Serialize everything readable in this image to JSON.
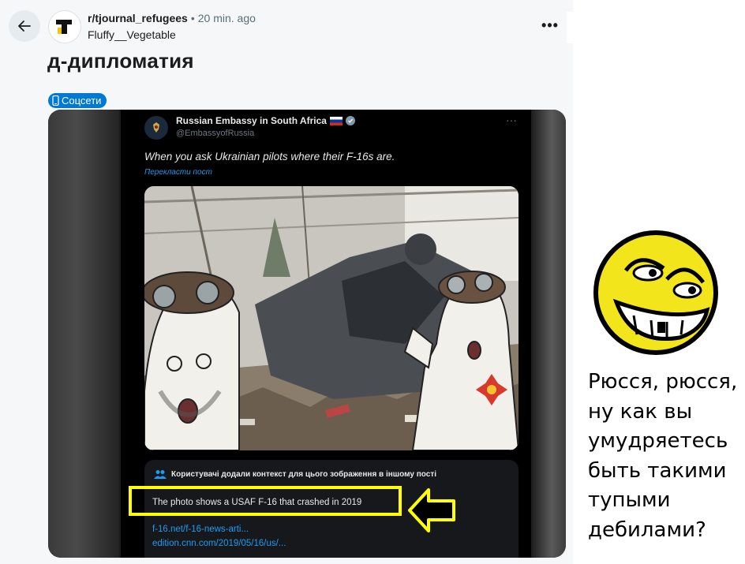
{
  "header": {
    "back_icon": "arrow-left-icon",
    "subreddit": "r/tjournal_refugees",
    "separator": "•",
    "time": "20 min. ago",
    "author": "Fluffy__Vegetable",
    "more_label": "•••"
  },
  "post": {
    "title": "д-дипломатия",
    "flair": "Соцсети",
    "flair_icon": "phone-icon"
  },
  "tweet": {
    "name": "Russian Embassy in South Africa",
    "handle": "@EmbassyofRussia",
    "text": "When you ask Ukrainian pilots where their F-16s are.",
    "translate": "Перекласти пост",
    "note_header": "Користувачі додали контекст для цього зображення в іншому пості",
    "note_text": "The photo shows a USAF F-16 that crashed in 2019",
    "link1": "f-16.net/f-16-news-arti...",
    "link2": "edition.cnn.com/2019/05/16/us/..."
  },
  "side": {
    "lines": [
      "Рюсся, рюсся,",
      "ну как вы",
      "умудряетесь",
      "быть такими",
      "тупыми",
      "дебилами?"
    ]
  },
  "colors": {
    "flair": "#0079d3",
    "highlight": "#ffff00",
    "link": "#1d9bf0",
    "troll_face": "#f3e51b"
  }
}
